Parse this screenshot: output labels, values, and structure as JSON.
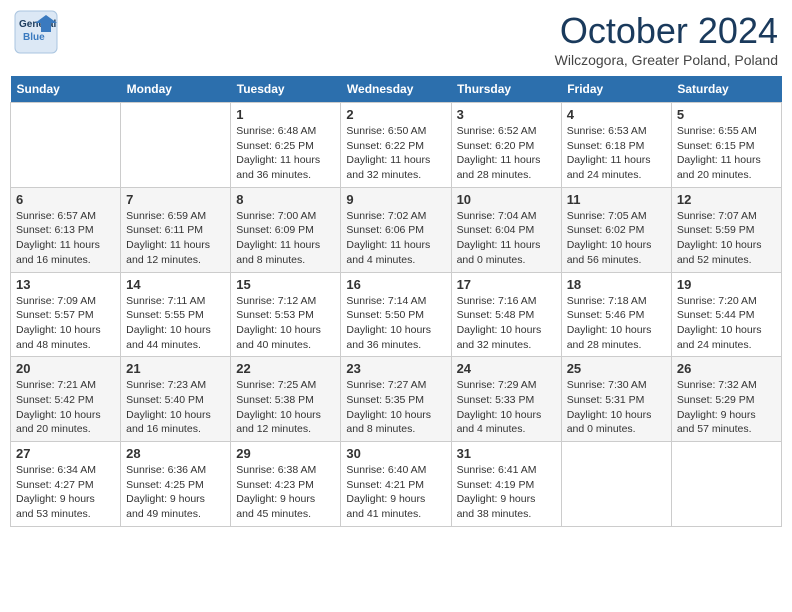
{
  "header": {
    "logo_line1": "General",
    "logo_line2": "Blue",
    "month": "October 2024",
    "location": "Wilczogora, Greater Poland, Poland"
  },
  "days_of_week": [
    "Sunday",
    "Monday",
    "Tuesday",
    "Wednesday",
    "Thursday",
    "Friday",
    "Saturday"
  ],
  "weeks": [
    [
      {
        "day": "",
        "sunrise": "",
        "sunset": "",
        "daylight": ""
      },
      {
        "day": "",
        "sunrise": "",
        "sunset": "",
        "daylight": ""
      },
      {
        "day": "1",
        "sunrise": "Sunrise: 6:48 AM",
        "sunset": "Sunset: 6:25 PM",
        "daylight": "Daylight: 11 hours and 36 minutes."
      },
      {
        "day": "2",
        "sunrise": "Sunrise: 6:50 AM",
        "sunset": "Sunset: 6:22 PM",
        "daylight": "Daylight: 11 hours and 32 minutes."
      },
      {
        "day": "3",
        "sunrise": "Sunrise: 6:52 AM",
        "sunset": "Sunset: 6:20 PM",
        "daylight": "Daylight: 11 hours and 28 minutes."
      },
      {
        "day": "4",
        "sunrise": "Sunrise: 6:53 AM",
        "sunset": "Sunset: 6:18 PM",
        "daylight": "Daylight: 11 hours and 24 minutes."
      },
      {
        "day": "5",
        "sunrise": "Sunrise: 6:55 AM",
        "sunset": "Sunset: 6:15 PM",
        "daylight": "Daylight: 11 hours and 20 minutes."
      }
    ],
    [
      {
        "day": "6",
        "sunrise": "Sunrise: 6:57 AM",
        "sunset": "Sunset: 6:13 PM",
        "daylight": "Daylight: 11 hours and 16 minutes."
      },
      {
        "day": "7",
        "sunrise": "Sunrise: 6:59 AM",
        "sunset": "Sunset: 6:11 PM",
        "daylight": "Daylight: 11 hours and 12 minutes."
      },
      {
        "day": "8",
        "sunrise": "Sunrise: 7:00 AM",
        "sunset": "Sunset: 6:09 PM",
        "daylight": "Daylight: 11 hours and 8 minutes."
      },
      {
        "day": "9",
        "sunrise": "Sunrise: 7:02 AM",
        "sunset": "Sunset: 6:06 PM",
        "daylight": "Daylight: 11 hours and 4 minutes."
      },
      {
        "day": "10",
        "sunrise": "Sunrise: 7:04 AM",
        "sunset": "Sunset: 6:04 PM",
        "daylight": "Daylight: 11 hours and 0 minutes."
      },
      {
        "day": "11",
        "sunrise": "Sunrise: 7:05 AM",
        "sunset": "Sunset: 6:02 PM",
        "daylight": "Daylight: 10 hours and 56 minutes."
      },
      {
        "day": "12",
        "sunrise": "Sunrise: 7:07 AM",
        "sunset": "Sunset: 5:59 PM",
        "daylight": "Daylight: 10 hours and 52 minutes."
      }
    ],
    [
      {
        "day": "13",
        "sunrise": "Sunrise: 7:09 AM",
        "sunset": "Sunset: 5:57 PM",
        "daylight": "Daylight: 10 hours and 48 minutes."
      },
      {
        "day": "14",
        "sunrise": "Sunrise: 7:11 AM",
        "sunset": "Sunset: 5:55 PM",
        "daylight": "Daylight: 10 hours and 44 minutes."
      },
      {
        "day": "15",
        "sunrise": "Sunrise: 7:12 AM",
        "sunset": "Sunset: 5:53 PM",
        "daylight": "Daylight: 10 hours and 40 minutes."
      },
      {
        "day": "16",
        "sunrise": "Sunrise: 7:14 AM",
        "sunset": "Sunset: 5:50 PM",
        "daylight": "Daylight: 10 hours and 36 minutes."
      },
      {
        "day": "17",
        "sunrise": "Sunrise: 7:16 AM",
        "sunset": "Sunset: 5:48 PM",
        "daylight": "Daylight: 10 hours and 32 minutes."
      },
      {
        "day": "18",
        "sunrise": "Sunrise: 7:18 AM",
        "sunset": "Sunset: 5:46 PM",
        "daylight": "Daylight: 10 hours and 28 minutes."
      },
      {
        "day": "19",
        "sunrise": "Sunrise: 7:20 AM",
        "sunset": "Sunset: 5:44 PM",
        "daylight": "Daylight: 10 hours and 24 minutes."
      }
    ],
    [
      {
        "day": "20",
        "sunrise": "Sunrise: 7:21 AM",
        "sunset": "Sunset: 5:42 PM",
        "daylight": "Daylight: 10 hours and 20 minutes."
      },
      {
        "day": "21",
        "sunrise": "Sunrise: 7:23 AM",
        "sunset": "Sunset: 5:40 PM",
        "daylight": "Daylight: 10 hours and 16 minutes."
      },
      {
        "day": "22",
        "sunrise": "Sunrise: 7:25 AM",
        "sunset": "Sunset: 5:38 PM",
        "daylight": "Daylight: 10 hours and 12 minutes."
      },
      {
        "day": "23",
        "sunrise": "Sunrise: 7:27 AM",
        "sunset": "Sunset: 5:35 PM",
        "daylight": "Daylight: 10 hours and 8 minutes."
      },
      {
        "day": "24",
        "sunrise": "Sunrise: 7:29 AM",
        "sunset": "Sunset: 5:33 PM",
        "daylight": "Daylight: 10 hours and 4 minutes."
      },
      {
        "day": "25",
        "sunrise": "Sunrise: 7:30 AM",
        "sunset": "Sunset: 5:31 PM",
        "daylight": "Daylight: 10 hours and 0 minutes."
      },
      {
        "day": "26",
        "sunrise": "Sunrise: 7:32 AM",
        "sunset": "Sunset: 5:29 PM",
        "daylight": "Daylight: 9 hours and 57 minutes."
      }
    ],
    [
      {
        "day": "27",
        "sunrise": "Sunrise: 6:34 AM",
        "sunset": "Sunset: 4:27 PM",
        "daylight": "Daylight: 9 hours and 53 minutes."
      },
      {
        "day": "28",
        "sunrise": "Sunrise: 6:36 AM",
        "sunset": "Sunset: 4:25 PM",
        "daylight": "Daylight: 9 hours and 49 minutes."
      },
      {
        "day": "29",
        "sunrise": "Sunrise: 6:38 AM",
        "sunset": "Sunset: 4:23 PM",
        "daylight": "Daylight: 9 hours and 45 minutes."
      },
      {
        "day": "30",
        "sunrise": "Sunrise: 6:40 AM",
        "sunset": "Sunset: 4:21 PM",
        "daylight": "Daylight: 9 hours and 41 minutes."
      },
      {
        "day": "31",
        "sunrise": "Sunrise: 6:41 AM",
        "sunset": "Sunset: 4:19 PM",
        "daylight": "Daylight: 9 hours and 38 minutes."
      },
      {
        "day": "",
        "sunrise": "",
        "sunset": "",
        "daylight": ""
      },
      {
        "day": "",
        "sunrise": "",
        "sunset": "",
        "daylight": ""
      }
    ]
  ]
}
